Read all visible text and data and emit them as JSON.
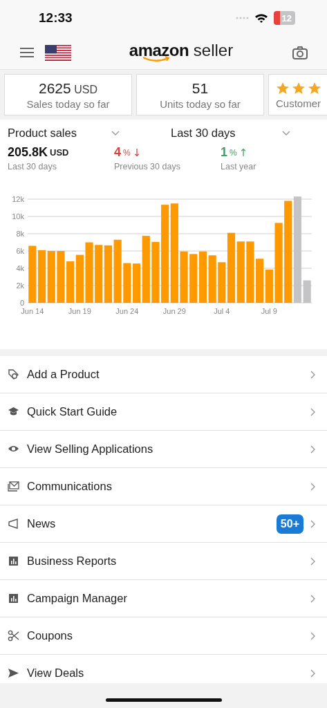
{
  "status_bar": {
    "time": "12:33",
    "battery": "12"
  },
  "header": {
    "logo_bold": "amazon",
    "logo_light": "seller"
  },
  "summary_cards": [
    {
      "value": "2625",
      "unit": "USD",
      "label": "Sales today so far"
    },
    {
      "value": "51",
      "label": "Units today so far"
    },
    {
      "stars": 3,
      "label": "Customer"
    }
  ],
  "sales": {
    "metric_dropdown": "Product sales",
    "period_dropdown": "Last 30 days",
    "stats": [
      {
        "value": "205.8K",
        "unit": "USD",
        "label": "Last 30 days",
        "color": "#111111"
      },
      {
        "value": "4",
        "unit": "%",
        "arrow": "↓",
        "label": "Previous 30 days",
        "color": "#e0403a"
      },
      {
        "value": "1",
        "unit": "%",
        "arrow": "↑",
        "label": "Last year",
        "color": "#3aa55c"
      }
    ],
    "chart_data": {
      "type": "bar",
      "stacked": true,
      "grid": true,
      "categories": [
        "Jun 14",
        null,
        null,
        null,
        null,
        "Jun 19",
        null,
        null,
        null,
        null,
        "Jun 24",
        null,
        null,
        null,
        null,
        "Jun 29",
        null,
        null,
        null,
        null,
        "Jul 4",
        null,
        null,
        null,
        null,
        "Jul 9",
        null,
        null,
        null,
        null
      ],
      "series": [
        {
          "color": "#ff9900",
          "values": [
            6600,
            6100,
            6000,
            6000,
            4800,
            5550,
            7000,
            6700,
            6650,
            7300,
            4600,
            4550,
            7750,
            7050,
            11350,
            11500,
            5950,
            5650,
            5950,
            5500,
            4700,
            8100,
            7100,
            7100,
            5100,
            3850,
            9250,
            11800,
            null,
            null
          ]
        },
        {
          "color": "#c4c4c6",
          "values": [
            null,
            null,
            null,
            null,
            null,
            null,
            null,
            null,
            null,
            null,
            null,
            null,
            null,
            null,
            null,
            null,
            null,
            null,
            null,
            null,
            null,
            null,
            null,
            null,
            null,
            null,
            null,
            null,
            12300,
            2600
          ]
        }
      ],
      "ylim": [
        0,
        12400
      ],
      "yticks": [
        {
          "value": 0,
          "label": "0"
        },
        {
          "value": 2000,
          "label": "2k"
        },
        {
          "value": 4000,
          "label": "4k"
        },
        {
          "value": 6000,
          "label": "6k"
        },
        {
          "value": 8000,
          "label": "8k"
        },
        {
          "value": 10000,
          "label": "10k"
        },
        {
          "value": 12000,
          "label": "12k"
        }
      ]
    }
  },
  "menu": [
    {
      "label": "Add a Product"
    },
    {
      "label": "Quick Start Guide"
    },
    {
      "label": "View Selling Applications"
    },
    {
      "label": "Communications"
    },
    {
      "label": "News",
      "badge": "50+"
    },
    {
      "label": "Business Reports"
    },
    {
      "label": "Campaign Manager"
    },
    {
      "label": "Coupons"
    },
    {
      "label": "View Deals"
    }
  ]
}
